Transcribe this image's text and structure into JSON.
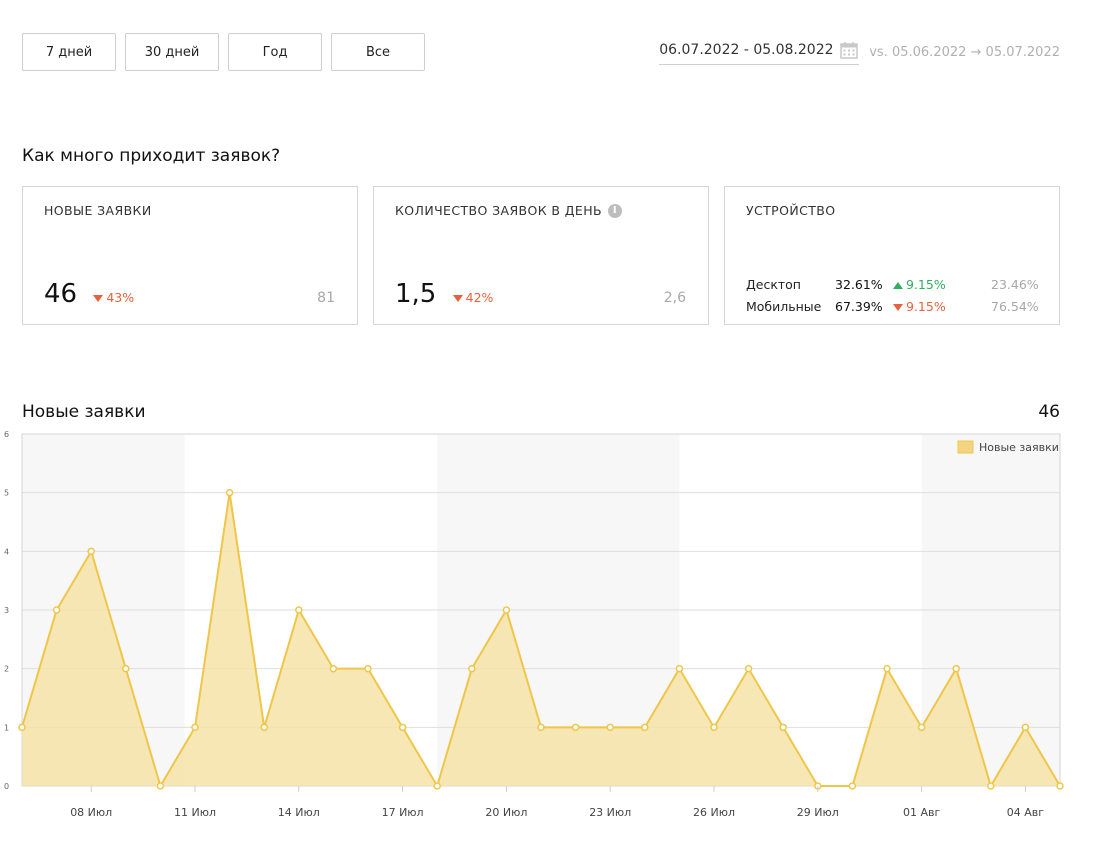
{
  "periods": [
    "7 дней",
    "30 дней",
    "Год",
    "Все"
  ],
  "date_range": {
    "current": "06.07.2022 - 05.08.2022",
    "compare": "vs. 05.06.2022 → 05.07.2022",
    "icon": "calendar-icon"
  },
  "section_title": "Как много приходит заявок?",
  "cards": {
    "new_leads": {
      "label": "Новые заявки",
      "value": "46",
      "delta": "43%",
      "prev": "81"
    },
    "per_day": {
      "label": "Количество заявок в день",
      "value": "1,5",
      "delta": "42%",
      "prev": "2,6",
      "icon": "info-icon"
    },
    "device": {
      "label": "Устройство",
      "rows": [
        {
          "name": "Десктоп",
          "share": "32.61%",
          "delta": "9.15%",
          "direction": "up",
          "prev": "23.46%"
        },
        {
          "name": "Мобильные",
          "share": "67.39%",
          "delta": "9.15%",
          "direction": "down",
          "prev": "76.54%"
        }
      ]
    }
  },
  "chart_title": "Новые заявки",
  "chart_total": "46",
  "chart_data": {
    "type": "area",
    "x": [
      "06.07",
      "07.07",
      "08.07",
      "09.07",
      "10.07",
      "11.07",
      "12.07",
      "13.07",
      "14.07",
      "15.07",
      "16.07",
      "17.07",
      "18.07",
      "19.07",
      "20.07",
      "21.07",
      "22.07",
      "23.07",
      "24.07",
      "25.07",
      "26.07",
      "27.07",
      "28.07",
      "29.07",
      "30.07",
      "31.07",
      "01.08",
      "02.08",
      "03.08",
      "04.08",
      "05.08"
    ],
    "tick_labels": [
      "08 Июл",
      "11 Июл",
      "14 Июл",
      "17 Июл",
      "20 Июл",
      "23 Июл",
      "26 Июл",
      "29 Июл",
      "01 Авг",
      "04 Авг"
    ],
    "tick_index": [
      2,
      5,
      8,
      11,
      14,
      17,
      20,
      23,
      26,
      29
    ],
    "series": [
      {
        "name": "Новые заявки",
        "values": [
          1,
          3,
          4,
          2,
          0,
          1,
          5,
          1,
          3,
          2,
          2,
          1,
          0,
          2,
          3,
          1,
          1,
          1,
          1,
          2,
          1,
          2,
          1,
          0,
          0,
          2,
          1,
          2,
          0,
          1,
          0
        ]
      }
    ],
    "ylim": [
      0,
      6
    ],
    "yticks": [
      0,
      1,
      2,
      3,
      4,
      5,
      6
    ],
    "grid": true,
    "legend": "top-right",
    "colors": {
      "fill": "#f5e3a7",
      "line": "#f0c64a",
      "band": "#f7f7f7"
    }
  }
}
